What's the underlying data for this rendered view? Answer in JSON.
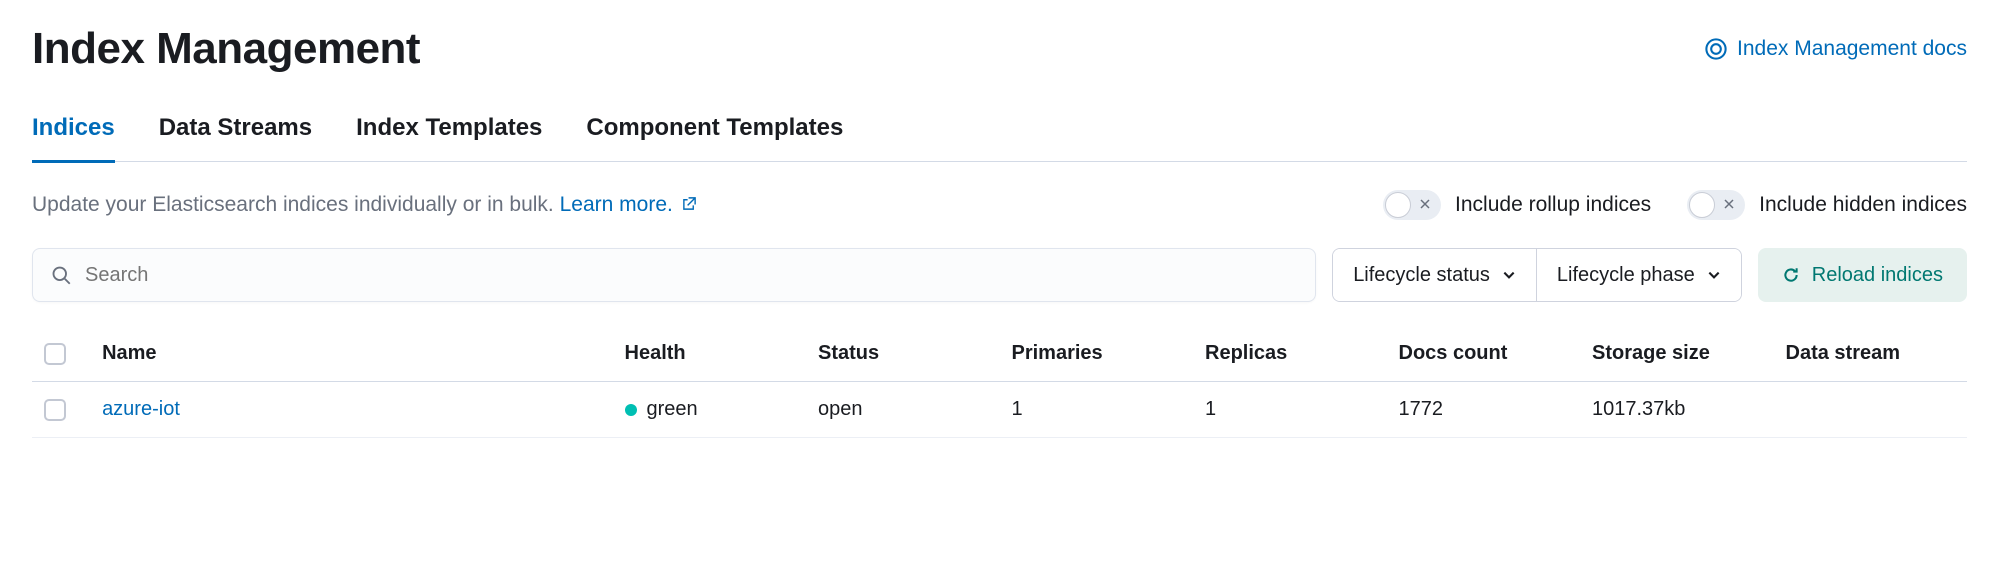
{
  "header": {
    "title": "Index Management",
    "docs_link": "Index Management docs"
  },
  "tabs": [
    {
      "label": "Indices",
      "active": true
    },
    {
      "label": "Data Streams",
      "active": false
    },
    {
      "label": "Index Templates",
      "active": false
    },
    {
      "label": "Component Templates",
      "active": false
    }
  ],
  "description": {
    "text": "Update your Elasticsearch indices individually or in bulk. ",
    "learn_more": "Learn more."
  },
  "switches": {
    "rollup": {
      "label": "Include rollup indices",
      "on": false
    },
    "hidden": {
      "label": "Include hidden indices",
      "on": false
    }
  },
  "search": {
    "placeholder": "Search",
    "value": ""
  },
  "filters": {
    "lifecycle_status": "Lifecycle status",
    "lifecycle_phase": "Lifecycle phase"
  },
  "reload_button": "Reload indices",
  "table": {
    "columns": [
      "Name",
      "Health",
      "Status",
      "Primaries",
      "Replicas",
      "Docs count",
      "Storage size",
      "Data stream"
    ],
    "rows": [
      {
        "name": "azure-iot",
        "health": "green",
        "status": "open",
        "primaries": "1",
        "replicas": "1",
        "docs_count": "1772",
        "storage_size": "1017.37kb",
        "data_stream": ""
      }
    ]
  }
}
